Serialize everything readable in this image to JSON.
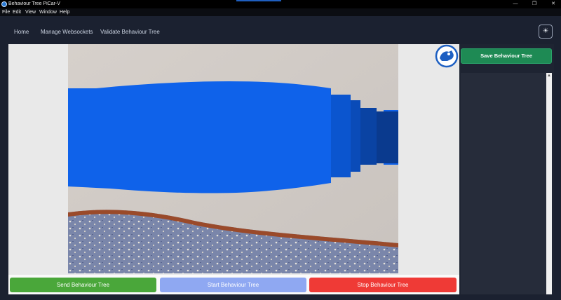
{
  "window": {
    "title": "Behaviour Tree PiCar-V",
    "controls": {
      "minimize": "—",
      "maximize": "❐",
      "close": "✕"
    }
  },
  "menu": [
    "File",
    "Edit",
    "View",
    "Window",
    "Help"
  ],
  "nav": {
    "links": [
      "Home",
      "Manage Websockets",
      "Validate Behaviour Tree"
    ],
    "theme_toggle_icon": "sun-icon",
    "theme_toggle_glyph": "☀"
  },
  "camera": {
    "description_icon": "camera-feed"
  },
  "actions": {
    "send": "Send Behaviour Tree",
    "start": "Start Behaviour Tree",
    "stop": "Stop Behaviour Tree"
  },
  "sidebar": {
    "save": "Save Behaviour Tree",
    "scroll_up": "▲"
  },
  "colors": {
    "send": "#4aa73a",
    "start": "#8fa8f2",
    "stop": "#ef3a36",
    "save": "#1e8a54",
    "background": "#1b2130"
  }
}
